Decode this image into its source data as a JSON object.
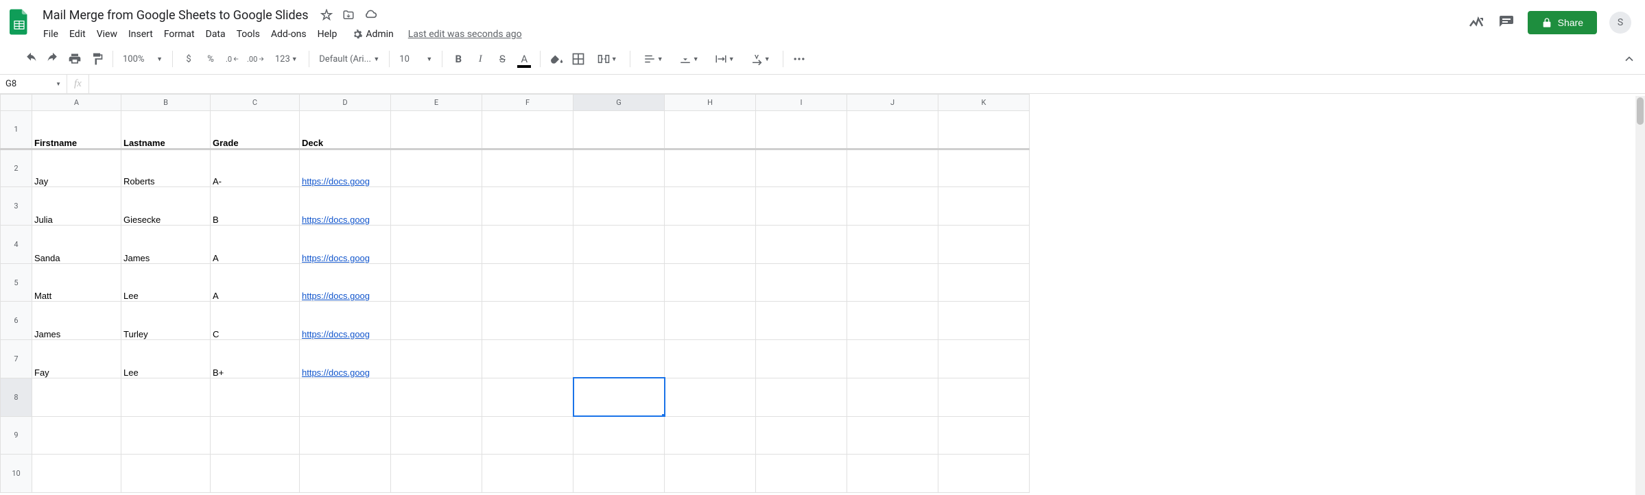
{
  "doc": {
    "title": "Mail Merge from Google Sheets to Google Slides",
    "last_edit": "Last edit was seconds ago"
  },
  "menu": {
    "file": "File",
    "edit": "Edit",
    "view": "View",
    "insert": "Insert",
    "format": "Format",
    "data": "Data",
    "tools": "Tools",
    "addons": "Add-ons",
    "help": "Help",
    "admin": "Admin"
  },
  "header": {
    "share": "Share",
    "avatar_initial": "S"
  },
  "toolbar": {
    "zoom": "100%",
    "currency": "$",
    "percent": "%",
    "dec_dec": ".0",
    "inc_dec": ".00",
    "more_formats": "123",
    "font": "Default (Ari...",
    "font_size": "10",
    "bold": "B",
    "italic": "I",
    "strike": "S",
    "text_a": "A"
  },
  "name_box": "G8",
  "fx": "fx",
  "columns": [
    "A",
    "B",
    "C",
    "D",
    "E",
    "F",
    "G",
    "H",
    "I",
    "J",
    "K"
  ],
  "col_widths": {
    "A": 130,
    "B": 130,
    "C": 130,
    "D": 133,
    "E": 133,
    "F": 133,
    "G": 133,
    "H": 133,
    "I": 133,
    "J": 133,
    "K": 133
  },
  "row_count": 10,
  "selected_cell": {
    "row": 8,
    "col": "G"
  },
  "headers_row": {
    "A": "Firstname",
    "B": "Lastname",
    "C": "Grade",
    "D": "Deck"
  },
  "data_rows": [
    {
      "A": "Jay",
      "B": "Roberts",
      "C": "A-",
      "D": "https://docs.goog"
    },
    {
      "A": "Julia",
      "B": "Giesecke",
      "C": "B",
      "D": "https://docs.goog"
    },
    {
      "A": "Sanda",
      "B": "James",
      "C": "A",
      "D": "https://docs.goog"
    },
    {
      "A": "Matt",
      "B": "Lee",
      "C": "A",
      "D": "https://docs.goog"
    },
    {
      "A": "James",
      "B": "Turley",
      "C": "C",
      "D": "https://docs.goog"
    },
    {
      "A": "Fay",
      "B": "Lee",
      "C": "B+",
      "D": "https://docs.goog"
    }
  ]
}
